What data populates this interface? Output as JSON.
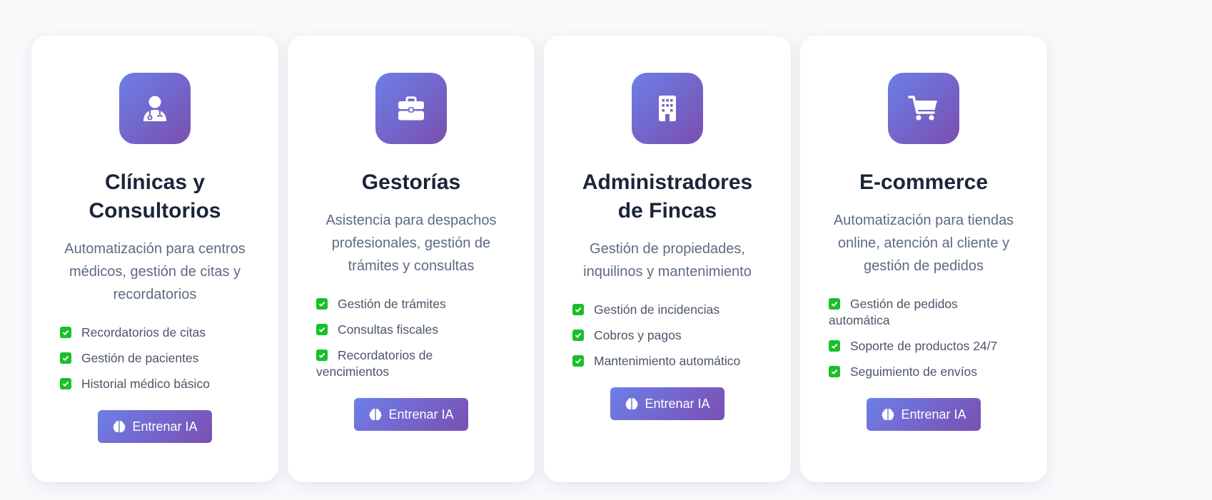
{
  "cards": [
    {
      "icon": "doctor-icon",
      "title_lines": [
        "Clínicas y",
        "Consultorios"
      ],
      "description_lines": [
        "Automatización para centros",
        "médicos, gestión de citas y",
        "recordatorios"
      ],
      "features": [
        {
          "lines": [
            "Recordatorios de citas"
          ]
        },
        {
          "lines": [
            "Gestión de pacientes"
          ]
        },
        {
          "lines": [
            "Historial médico básico"
          ]
        }
      ],
      "button_label": "Entrenar IA"
    },
    {
      "icon": "briefcase-icon",
      "title_lines": [
        "Gestorías"
      ],
      "description_lines": [
        "Asistencia para despachos",
        "profesionales, gestión de",
        "trámites y consultas"
      ],
      "features": [
        {
          "lines": [
            "Gestión de trámites"
          ]
        },
        {
          "lines": [
            "Consultas fiscales"
          ]
        },
        {
          "lines": [
            "Recordatorios de",
            "vencimientos"
          ]
        }
      ],
      "button_label": "Entrenar IA"
    },
    {
      "icon": "building-icon",
      "title_lines": [
        "Administradores",
        "de Fincas"
      ],
      "description_lines": [
        "Gestión de propiedades,",
        "inquilinos y mantenimiento"
      ],
      "features": [
        {
          "lines": [
            "Gestión de incidencias"
          ]
        },
        {
          "lines": [
            "Cobros y pagos"
          ]
        },
        {
          "lines": [
            "Mantenimiento automático"
          ]
        }
      ],
      "button_label": "Entrenar IA"
    },
    {
      "icon": "shopping-cart-icon",
      "title_lines": [
        "E-commerce"
      ],
      "description_lines": [
        "Automatización para tiendas",
        "online, atención al cliente y",
        "gestión de pedidos"
      ],
      "features": [
        {
          "lines": [
            "Gestión de pedidos",
            "automática"
          ]
        },
        {
          "lines": [
            "Soporte de productos 24/7"
          ]
        },
        {
          "lines": [
            "Seguimiento de envíos"
          ]
        }
      ],
      "button_label": "Entrenar IA"
    }
  ],
  "colors": {
    "accent_gradient_start": "#6b7fe6",
    "accent_gradient_end": "#7a4fb0",
    "check_green": "#18c02a",
    "title_text": "#1b2538",
    "body_text": "#5d6b83"
  },
  "button_icon": "brain-icon"
}
